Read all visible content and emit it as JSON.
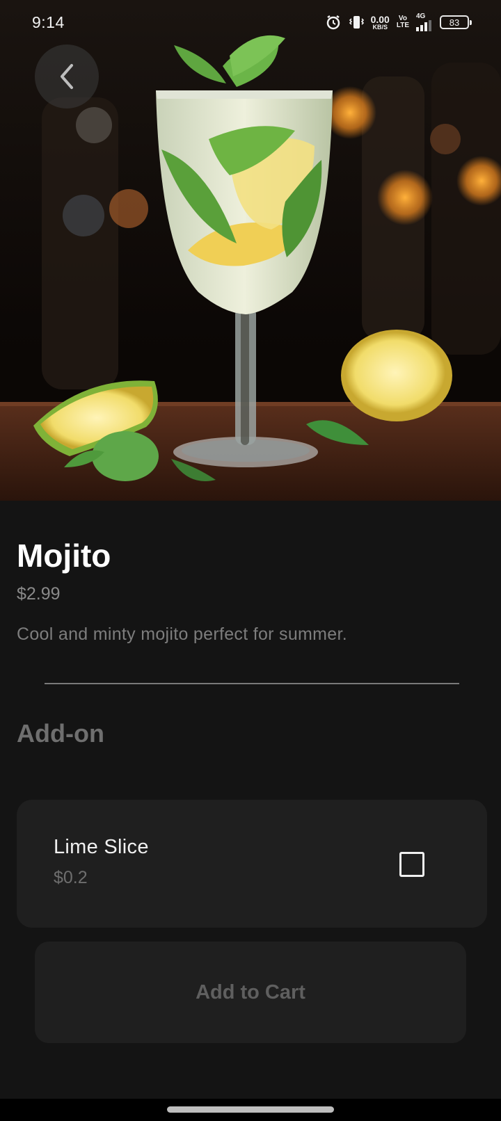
{
  "status_bar": {
    "time": "9:14",
    "net_speed_value": "0.00",
    "net_speed_unit": "KB/S",
    "volte_top": "Vo",
    "volte_bottom": "LTE",
    "network": "4G",
    "battery": "83",
    "icons": [
      "alarm-icon",
      "vibrate-icon",
      "signal-icon",
      "battery-icon"
    ]
  },
  "header": {
    "back_icon": "chevron-left-icon"
  },
  "hero": {
    "image": "mojito-cocktail-photo"
  },
  "product": {
    "title": "Mojito",
    "price": "$2.99",
    "description": "Cool and minty mojito perfect for summer."
  },
  "addons": {
    "heading": "Add-on",
    "items": [
      {
        "name": "Lime Slice",
        "price": "$0.2",
        "checked": false
      }
    ]
  },
  "actions": {
    "add_to_cart_label": "Add to Cart"
  },
  "colors": {
    "background": "#141414",
    "card": "#1f1f1f",
    "muted_text": "#7d7d7d"
  }
}
